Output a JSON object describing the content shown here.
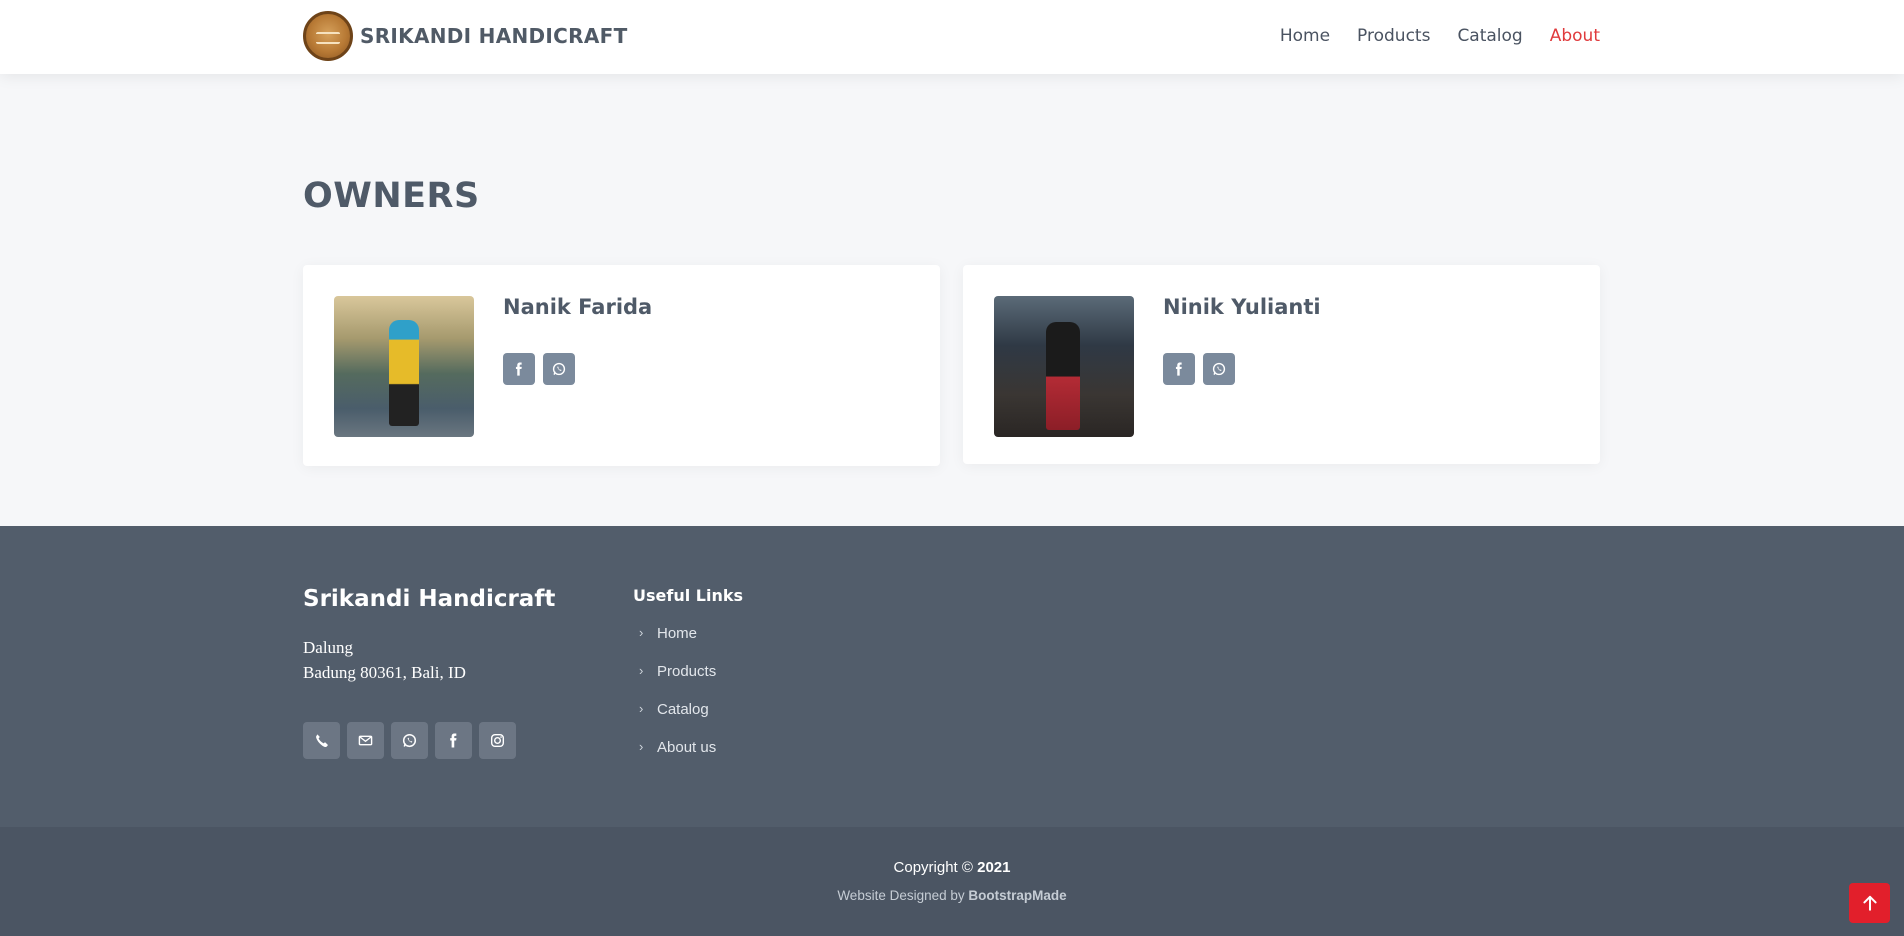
{
  "header": {
    "brand": "SRIKANDI HANDICRAFT",
    "nav": [
      "Home",
      "Products",
      "Catalog",
      "About"
    ],
    "active_nav": "About"
  },
  "owners": {
    "title": "OWNERS",
    "people": [
      {
        "name": "Nanik Farida",
        "social": [
          "facebook-icon",
          "whatsapp-icon"
        ]
      },
      {
        "name": "Ninik Yulianti",
        "social": [
          "facebook-icon",
          "whatsapp-icon"
        ]
      }
    ]
  },
  "footer": {
    "brand": "Srikandi Handicraft",
    "address_line1": "Dalung",
    "address_line2": "Badung 80361, Bali, ID",
    "social_icons": [
      "phone-icon",
      "email-icon",
      "whatsapp-icon",
      "facebook-icon",
      "instagram-icon"
    ],
    "links_title": "Useful Links",
    "links": [
      "Home",
      "Products",
      "Catalog",
      "About us"
    ],
    "copyright_prefix": "Copyright ©",
    "copyright_year": "2021",
    "credits_prefix": "Website Designed by",
    "credits_name": "BootstrapMade"
  },
  "colors": {
    "accent": "#e03a3c",
    "footer_bg": "#525d6b",
    "footer_bottom_bg": "#4b5563",
    "back_to_top": "#e21f2b"
  }
}
